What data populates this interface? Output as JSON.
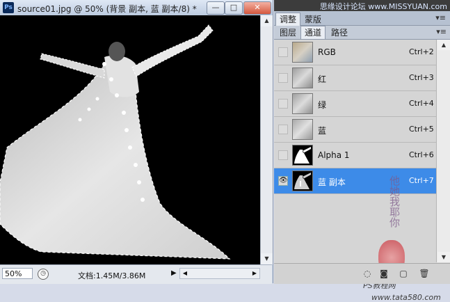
{
  "document": {
    "title": "source01.jpg @ 50% (背景 副本, 蓝 副本/8) *",
    "app_icon": "Ps",
    "zoom": "50%",
    "doc_size": "文档:1.45M/3.86M",
    "window_buttons": {
      "minimize": "—",
      "maximize": "□",
      "close": "✕"
    }
  },
  "panel": {
    "top_tabs": [
      {
        "label": "调整"
      },
      {
        "label": "蒙版"
      }
    ],
    "top_watermark": "思缘设计论坛 www.MISSYUAN.com",
    "sub_tabs": [
      {
        "label": "图层"
      },
      {
        "label": "通道"
      },
      {
        "label": "路径"
      }
    ],
    "active_sub_tab": "通道",
    "channels": [
      {
        "name": "RGB",
        "shortcut": "Ctrl+2",
        "visible": false,
        "selected": false,
        "thumb": "color"
      },
      {
        "name": "红",
        "shortcut": "Ctrl+3",
        "visible": false,
        "selected": false,
        "thumb": "gray"
      },
      {
        "name": "绿",
        "shortcut": "Ctrl+4",
        "visible": false,
        "selected": false,
        "thumb": "gray"
      },
      {
        "name": "蓝",
        "shortcut": "Ctrl+5",
        "visible": false,
        "selected": false,
        "thumb": "gray"
      },
      {
        "name": "Alpha 1",
        "shortcut": "Ctrl+6",
        "visible": false,
        "selected": false,
        "thumb": "mask"
      },
      {
        "name": "蓝 副本",
        "shortcut": "Ctrl+7",
        "visible": true,
        "selected": true,
        "thumb": "mask-dark"
      }
    ],
    "watermark_ps": "PS教程网",
    "watermark_url": "www.tata580.com",
    "calligraphy": "他她我耶你"
  },
  "colors": {
    "selection": "#3d8be8",
    "canvas": "#000000"
  }
}
